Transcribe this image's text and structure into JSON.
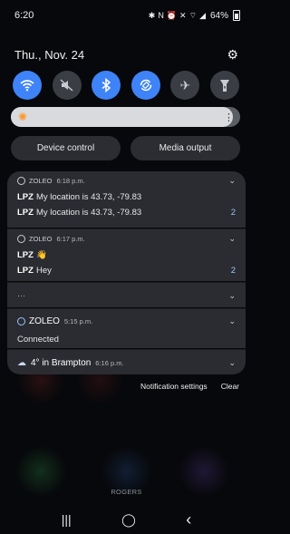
{
  "status_bar": {
    "time": "6:20",
    "battery": "64%",
    "icons": [
      "bluetooth-icon",
      "nfc-icon",
      "alarm-icon",
      "mute-icon",
      "wifi-icon",
      "signal-icon",
      "battery-icon"
    ]
  },
  "header": {
    "date": "Thu., Nov. 24",
    "settings_icon": "gear-icon"
  },
  "quick_settings": [
    {
      "name": "wifi",
      "icon": "wifi-icon",
      "state": "on"
    },
    {
      "name": "sound",
      "icon": "mute-icon",
      "state": "off"
    },
    {
      "name": "bluetooth",
      "icon": "bluetooth-icon",
      "state": "on"
    },
    {
      "name": "auto-rotate",
      "icon": "rotate-icon",
      "state": "on"
    },
    {
      "name": "airplane",
      "icon": "airplane-icon",
      "state": "off"
    },
    {
      "name": "flashlight",
      "icon": "flashlight-icon",
      "state": "off"
    }
  ],
  "brightness": {
    "level": 0.97
  },
  "buttons": {
    "device_control": "Device control",
    "media_output": "Media output"
  },
  "notifications": [
    {
      "app": "ZOLEO",
      "time": "6:18 p.m.",
      "lines": [
        {
          "sender": "LPZ",
          "text": "My location is 43.73",
          "tail": ", -79.83",
          "count": ""
        },
        {
          "sender": "LPZ",
          "text": "My location is 43.73",
          "tail": ", -79.83",
          "count": "2"
        }
      ]
    },
    {
      "app": "ZOLEO",
      "time": "6:17 p.m.",
      "lines": [
        {
          "sender": "LPZ",
          "text": "👋",
          "count": ""
        },
        {
          "sender": "LPZ",
          "text": "Hey",
          "count": "2"
        }
      ]
    },
    {
      "dots": "···"
    },
    {
      "app": "ZOLEO",
      "time": "5:15 p.m.",
      "body": "Connected"
    },
    {
      "app": "4° in Brampton",
      "time": "6:16 p.m."
    }
  ],
  "footer": {
    "notification_settings": "Notification settings",
    "clear": "Clear"
  },
  "carrier": "ROGERS",
  "nav": {
    "recents": "|||",
    "home": "◯",
    "back": "‹"
  },
  "colors": {
    "accent": "#3e83f7",
    "panel": "#2a2c31",
    "background": "#07080b"
  }
}
